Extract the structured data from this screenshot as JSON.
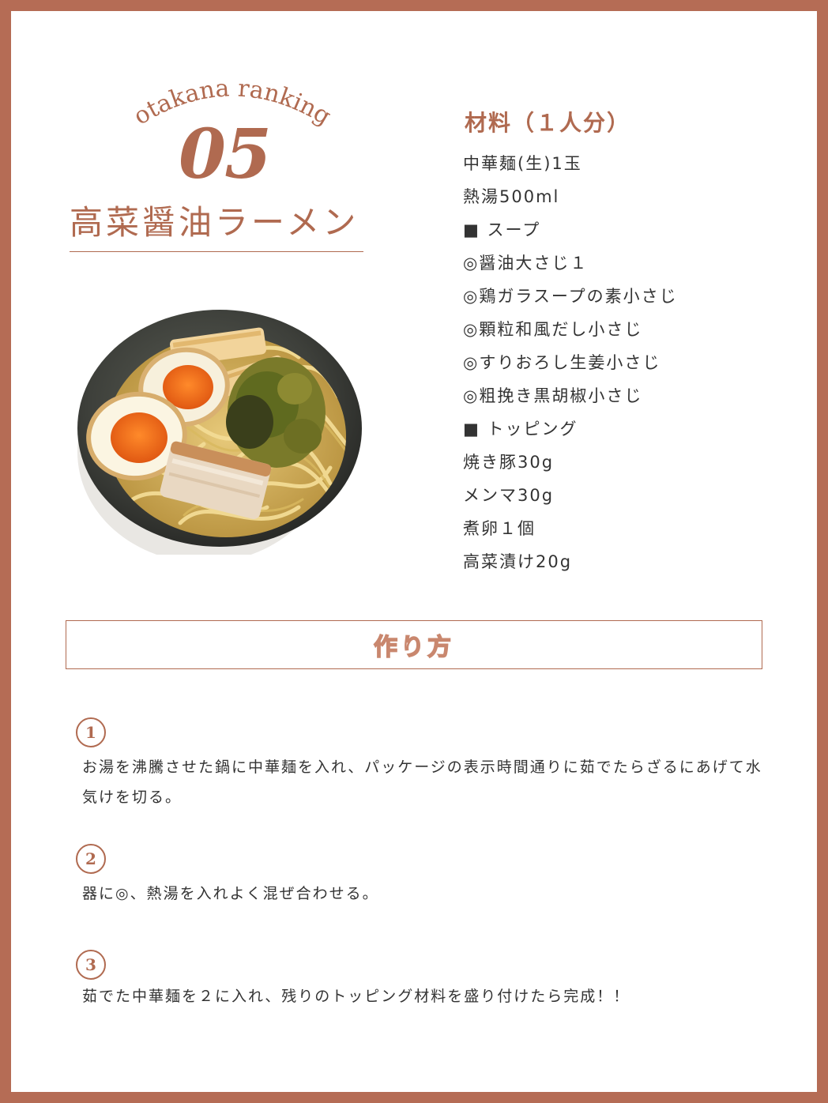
{
  "kicker": "otakana ranking",
  "rank_number": "05",
  "dish_title": "高菜醤油ラーメン",
  "ingredients_heading": "材料（１人分）",
  "ingredients": [
    "中華麺(生)1玉",
    "熱湯500ml",
    "■ スープ",
    "◎醤油大さじ１",
    "◎鶏ガラスープの素小さじ",
    "◎顆粒和風だし小さじ",
    "◎すりおろし生姜小さじ",
    "◎粗挽き黒胡椒小さじ",
    "■ トッピング",
    "焼き豚30g",
    "メンマ30g",
    "煮卵１個",
    "高菜漬け20g"
  ],
  "method_heading": "作り方",
  "steps": [
    {
      "number": "1",
      "text": "お湯を沸騰させた鍋に中華麺を入れ、パッケージの表示時間通りに茹でたらざるにあげて水気けを切る。"
    },
    {
      "number": "2",
      "text": "器に◎、熱湯を入れよく混ぜ合わせる。"
    },
    {
      "number": "3",
      "text": "茹でた中華麺を２に入れ、残りのトッピング材料を盛り付けたら完成！！"
    }
  ],
  "colors": {
    "accent": "#b06a50",
    "frame": "#b56c55",
    "text": "#333333"
  }
}
